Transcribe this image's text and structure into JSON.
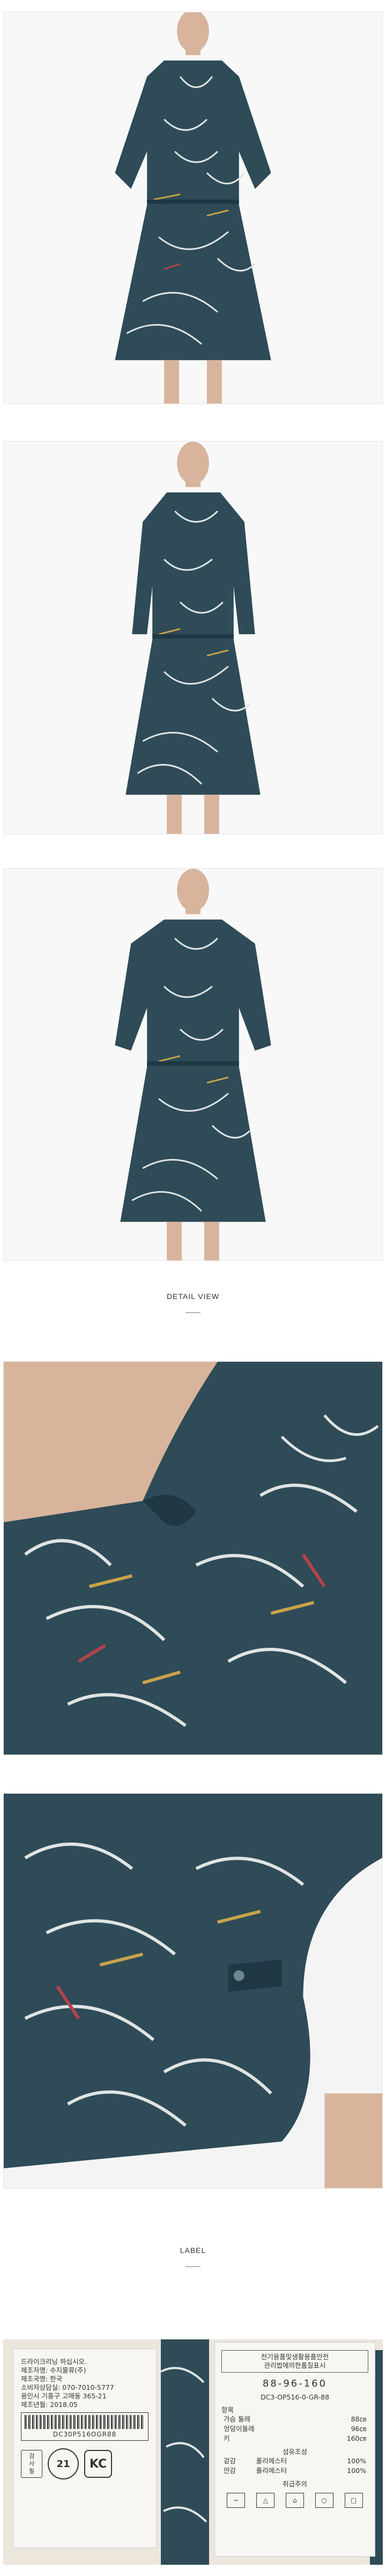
{
  "sections": {
    "detail_heading": "DETAIL VIEW",
    "label_heading": "LABEL"
  },
  "photos": [
    {
      "alt": "Model wearing navy floral chiffon dress with sleeves rolled, front view"
    },
    {
      "alt": "Model wearing navy floral chiffon dress, three-quarter front view"
    },
    {
      "alt": "Model wearing navy floral chiffon dress, side view"
    },
    {
      "alt": "Close-up of ruffled collar and print detail"
    },
    {
      "alt": "Close-up of sleeve cuff with button tab"
    }
  ],
  "colors": {
    "fabric": "#2e4b57",
    "fabric_dark": "#1f3843",
    "print_light": "#dfe4e3",
    "accent_mustard": "#c9a24a",
    "accent_red": "#b5424d",
    "skin": "#d8b49c",
    "background": "#f8f8f8"
  },
  "label_left": {
    "lines": [
      "드라이크리닝 하십시오.",
      "제조자명: 수지물류(주)",
      "제조국명: 한국",
      "소비자상담실: 070-7010-5777",
      "용인시 기흥구 고매동 365-21",
      "제조년월: 2018.05"
    ],
    "barcode_text": "DC30P516OGR88",
    "stamp_text_1": "검",
    "stamp_text_2": "사",
    "stamp_text_3": "필",
    "seal_text": "21",
    "kc_text": "KC"
  },
  "label_right": {
    "header_1": "전기용품및생활용품안전",
    "header_2": "관리법에의한품질표시",
    "size": "88-96-160",
    "code": "DC3-OP516-0-GR-88",
    "section_title": "항목",
    "rows": [
      {
        "name": "가슴 둘레",
        "value": "88㎝"
      },
      {
        "name": "엉덩이둘레",
        "value": "96㎝"
      },
      {
        "name": "키",
        "value": "160㎝"
      }
    ],
    "composition_title": "섬유조성",
    "composition": [
      {
        "part": "겉감",
        "fiber": "폴리에스터",
        "pct": "100%"
      },
      {
        "part": "안감",
        "fiber": "폴리에스터",
        "pct": "100%"
      }
    ],
    "care_title": "취급주의",
    "care_icons": [
      "wash-icon",
      "no-bleach-icon",
      "iron-icon",
      "dryclean-icon",
      "no-tumble-icon"
    ]
  }
}
